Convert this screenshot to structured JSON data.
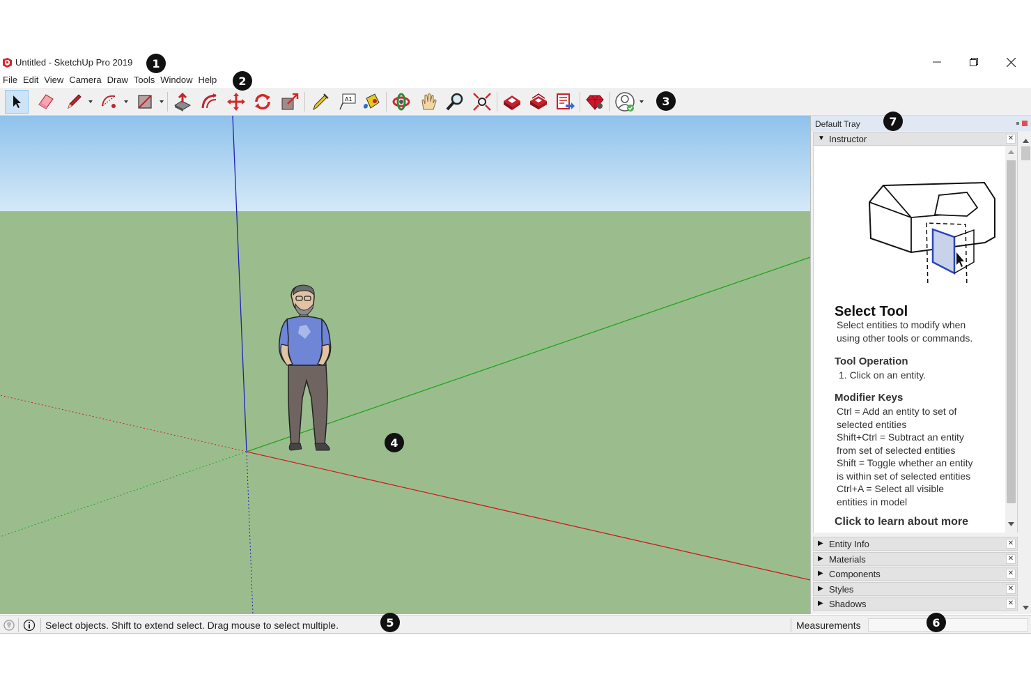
{
  "window": {
    "title": "Untitled - SketchUp Pro 2019",
    "controls": [
      "minimize",
      "restore",
      "close"
    ]
  },
  "callouts": [
    "1",
    "2",
    "3",
    "4",
    "5",
    "6",
    "7"
  ],
  "menu": [
    "File",
    "Edit",
    "View",
    "Camera",
    "Draw",
    "Tools",
    "Window",
    "Help"
  ],
  "toolbar": {
    "tools": [
      {
        "name": "select-tool",
        "icon": "arrow-cursor-icon",
        "active": true
      },
      {
        "name": "eraser-tool",
        "icon": "eraser-icon"
      },
      {
        "name": "line-tool",
        "icon": "pencil-icon",
        "dropdown": true
      },
      {
        "name": "arc-tool",
        "icon": "arc-icon",
        "dropdown": true
      },
      {
        "name": "rectangle-tool",
        "icon": "rectangle-icon",
        "dropdown": true
      },
      {
        "name": "push-pull-tool",
        "icon": "push-pull-icon"
      },
      {
        "name": "offset-tool",
        "icon": "offset-icon"
      },
      {
        "name": "move-tool",
        "icon": "move-icon"
      },
      {
        "name": "rotate-tool",
        "icon": "rotate-icon"
      },
      {
        "name": "scale-tool",
        "icon": "scale-icon"
      },
      {
        "name": "tape-measure-tool",
        "icon": "tape-measure-icon"
      },
      {
        "name": "text-tool",
        "icon": "text-icon",
        "glyph": "A1"
      },
      {
        "name": "paint-bucket-tool",
        "icon": "paint-bucket-icon"
      },
      {
        "name": "orbit-tool",
        "icon": "orbit-icon"
      },
      {
        "name": "pan-tool",
        "icon": "hand-icon"
      },
      {
        "name": "zoom-tool",
        "icon": "magnifier-icon"
      },
      {
        "name": "zoom-extents-tool",
        "icon": "zoom-extents-icon"
      },
      {
        "name": "3d-warehouse",
        "icon": "warehouse-icon"
      },
      {
        "name": "extension-warehouse",
        "icon": "extension-icon"
      },
      {
        "name": "send-to-layout",
        "icon": "layout-icon"
      },
      {
        "name": "extension-manager",
        "icon": "ruby-gem-icon"
      },
      {
        "name": "account",
        "icon": "user-account-icon",
        "dropdown": true
      }
    ]
  },
  "tray": {
    "title": "Default Tray",
    "instructor": {
      "label": "Instructor",
      "title": "Select Tool",
      "description": [
        "Select entities to modify when",
        "using other tools or commands."
      ],
      "operation_heading": "Tool Operation",
      "operation": "1. Click on an entity.",
      "modifier_heading": "Modifier Keys",
      "modifiers": [
        "Ctrl = Add an entity to set of",
        "selected entities",
        "Shift+Ctrl = Subtract an entity",
        "from set of selected entities",
        "Shift = Toggle whether an entity",
        "is within set of selected entities",
        "Ctrl+A = Select all visible",
        "entities in model"
      ],
      "learn_more": "Click to learn about more"
    },
    "panels": [
      "Entity Info",
      "Materials",
      "Components",
      "Styles",
      "Shadows"
    ]
  },
  "status": {
    "message": "Select objects. Shift to extend select. Drag mouse to select multiple.",
    "measurements_label": "Measurements",
    "measurements_value": ""
  },
  "colors": {
    "sky": "#8fc2ec",
    "ground": "#9bbd8e",
    "axis_red": "#c81e1e",
    "axis_green": "#1ea51e",
    "axis_blue": "#2020b4",
    "selection": "#cce4f7"
  }
}
